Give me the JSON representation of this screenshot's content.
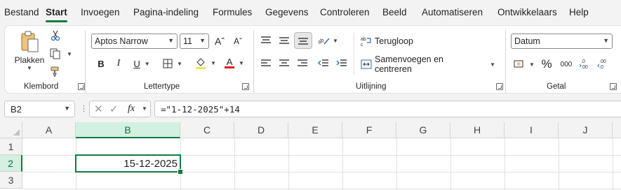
{
  "menu": {
    "tabs": [
      {
        "label": "Bestand"
      },
      {
        "label": "Start"
      },
      {
        "label": "Invoegen"
      },
      {
        "label": "Pagina-indeling"
      },
      {
        "label": "Formules"
      },
      {
        "label": "Gegevens"
      },
      {
        "label": "Controleren"
      },
      {
        "label": "Beeld"
      },
      {
        "label": "Automatiseren"
      },
      {
        "label": "Ontwikkelaars"
      },
      {
        "label": "Help"
      }
    ],
    "active": "Start"
  },
  "ribbon": {
    "clipboard": {
      "paste_label": "Plakken",
      "group_label": "Klembord"
    },
    "font": {
      "family": "Aptos Narrow",
      "size": "11",
      "group_label": "Lettertype",
      "font_color": "#e01b1b",
      "fill_color": "#f5e642"
    },
    "alignment": {
      "wrap_label": "Terugloop",
      "merge_label": "Samenvoegen en centreren",
      "group_label": "Uitlijning"
    },
    "number": {
      "format": "Datum",
      "percent": "%",
      "thousands": "000",
      "group_label": "Getal"
    }
  },
  "formula_bar": {
    "name_box": "B2",
    "fx": "fx",
    "formula": "=\"1-12-2025\"+14"
  },
  "sheet": {
    "columns": [
      "A",
      "B",
      "C",
      "D",
      "E",
      "F",
      "G",
      "H",
      "I",
      "J"
    ],
    "rows": [
      "1",
      "2",
      "3"
    ],
    "selected_cell": {
      "ref": "B2",
      "value": "15-12-2025"
    }
  },
  "colors": {
    "accent": "#107c41",
    "selected_header_bg": "#d3f0e0"
  }
}
